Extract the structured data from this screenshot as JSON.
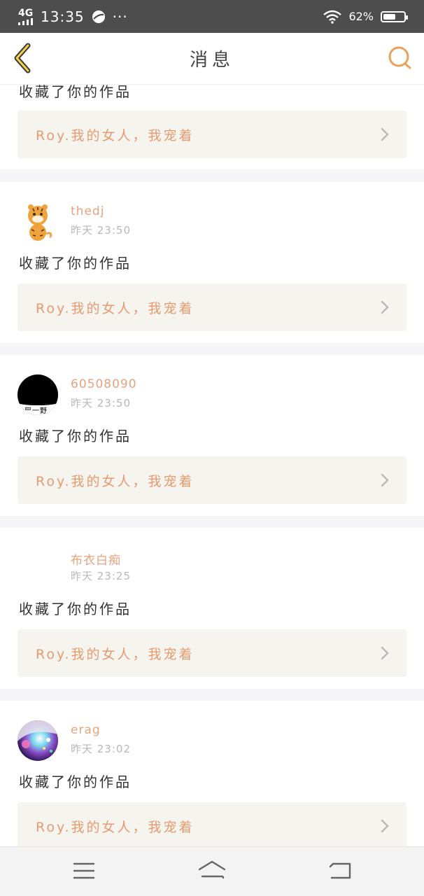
{
  "status_bar": {
    "network": "4G",
    "time": "13:35",
    "more": "···",
    "battery_percent": "62%",
    "battery_level": 0.62
  },
  "header": {
    "title": "消息",
    "back_icon": "chevron-left-icon",
    "search_icon": "search-icon",
    "accent_color": "#e8a25a"
  },
  "messages": [
    {
      "action": "收藏了你的作品",
      "work_title": "Roy.我的女人，我宠着"
    },
    {
      "username": "thedj",
      "time": "昨天 23:50",
      "avatar": "tiger-avatar",
      "action": "收藏了你的作品",
      "work_title": "Roy.我的女人，我宠着"
    },
    {
      "username": "60508090",
      "time": "昨天 23:50",
      "avatar": "black-circle-avatar",
      "avatar_caption": "罒一野",
      "action": "收藏了你的作品",
      "work_title": "Roy.我的女人，我宠着"
    },
    {
      "username": "布衣白痴",
      "time": "昨天 23:25",
      "avatar": "blank-avatar",
      "action": "收藏了你的作品",
      "work_title": "Roy.我的女人，我宠着"
    },
    {
      "username": "erag",
      "time": "昨天 23:02",
      "avatar": "galaxy-avatar",
      "action": "收藏了你的作品",
      "work_title": "Roy.我的女人，我宠着"
    }
  ],
  "nav": {
    "menu_icon": "menu-icon",
    "home_icon": "home-icon",
    "back_icon": "return-icon"
  }
}
